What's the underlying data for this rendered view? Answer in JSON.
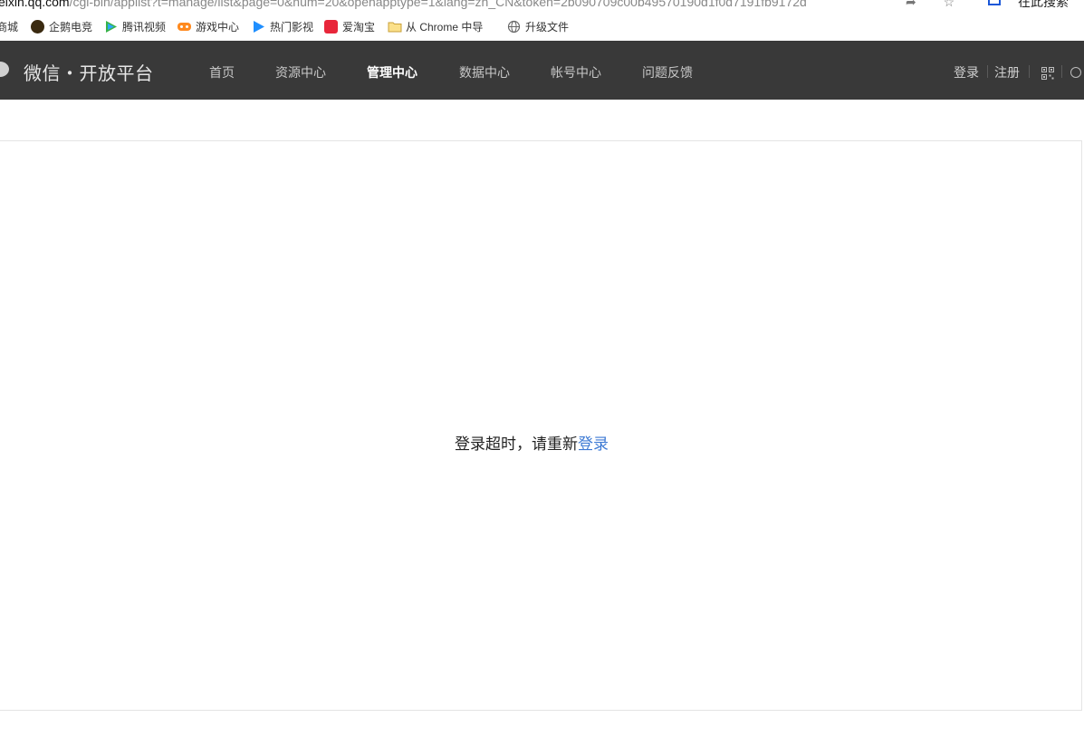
{
  "browser": {
    "url_host": "eixin.qq.com",
    "url_path": "/cgi-bin/applist?t=manage/list&page=0&num=20&openapptype=1&lang=zh_CN&token=2b090709c00b49570190d1f0d7191fb9172d",
    "extension_label": "在此搜索",
    "bookmarks": [
      {
        "label": "商城",
        "icon": "shop-icon",
        "color": "#ffffff"
      },
      {
        "label": "企鹅电竞",
        "icon": "penguin-esports-icon",
        "color": "#f2b233"
      },
      {
        "label": "腾讯视频",
        "icon": "tencent-video-icon",
        "color": "#2ea8ff"
      },
      {
        "label": "游戏中心",
        "icon": "game-center-icon",
        "color": "#ff8a1f"
      },
      {
        "label": "热门影视",
        "icon": "hot-video-icon",
        "color": "#1f8fff"
      },
      {
        "label": "爱淘宝",
        "icon": "ai-taobao-icon",
        "color": "#e8263a"
      },
      {
        "label": "从 Chrome 中导",
        "icon": "folder-icon",
        "color": "#f5cf5b"
      },
      {
        "label": "升级文件",
        "icon": "globe-icon",
        "color": "#666666"
      }
    ]
  },
  "nav": {
    "brand": "微信・开放平台",
    "menu": [
      {
        "label": "首页",
        "active": false
      },
      {
        "label": "资源中心",
        "active": false
      },
      {
        "label": "管理中心",
        "active": true
      },
      {
        "label": "数据中心",
        "active": false
      },
      {
        "label": "帐号中心",
        "active": false
      },
      {
        "label": "问题反馈",
        "active": false
      }
    ],
    "login_label": "登录",
    "register_label": "注册"
  },
  "main": {
    "message_text": "登录超时，请重新",
    "message_link": "登录"
  },
  "colors": {
    "nav_bg": "#393939",
    "link": "#3d7ad4"
  }
}
